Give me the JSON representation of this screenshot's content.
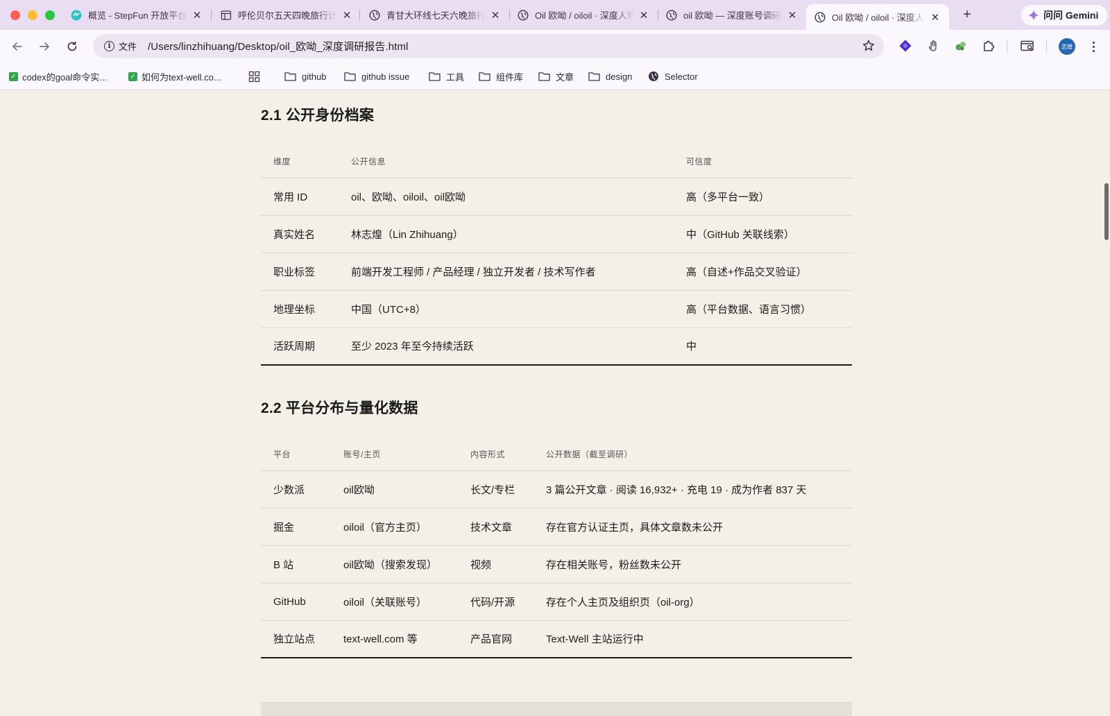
{
  "browser": {
    "tabs": [
      {
        "title": "概览 - StepFun 开放平台",
        "icon": "stepfun-icon"
      },
      {
        "title": "呼伦贝尔五天四晚旅行计划",
        "icon": "doc-icon"
      },
      {
        "title": "青甘大环线七天六晚旅行计划",
        "icon": "globe-icon"
      },
      {
        "title": "Oil 欧呦 / oiloil · 深度人物调研",
        "icon": "globe-icon"
      },
      {
        "title": "oil 欧呦 — 深度账号调研报告",
        "icon": "globe-icon"
      },
      {
        "title": "Oil 欧呦 / oiloil · 深度人物调研",
        "icon": "globe-icon",
        "active": true
      }
    ],
    "gemini_label": "问问 Gemini",
    "address": {
      "chip_label": "文件",
      "url": "/Users/linzhihuang/Desktop/oil_欧呦_深度调研报告.html"
    },
    "avatar_label": "志煌",
    "bookmarks": [
      {
        "label": "codex的goal命令实...",
        "icon": "check-icon"
      },
      {
        "label": "如何为text-well.co...",
        "icon": "check-icon"
      },
      {
        "label": "github",
        "icon": "folder-icon"
      },
      {
        "label": "github issue",
        "icon": "folder-icon"
      },
      {
        "label": "工具",
        "icon": "folder-icon"
      },
      {
        "label": "组件库",
        "icon": "folder-icon"
      },
      {
        "label": "文章",
        "icon": "folder-icon"
      },
      {
        "label": "design",
        "icon": "folder-icon"
      },
      {
        "label": "Selector",
        "icon": "globe-icon"
      }
    ]
  },
  "report": {
    "section_2_1": {
      "title": "2.1 公开身份档案",
      "headers": [
        "维度",
        "公开信息",
        "可信度"
      ],
      "rows": [
        [
          "常用 ID",
          "oil、欧呦、oiloil、oil欧呦",
          "高（多平台一致）"
        ],
        [
          "真实姓名",
          "林志煌（Lin Zhihuang）",
          "中（GitHub 关联线索）"
        ],
        [
          "职业标签",
          "前端开发工程师 / 产品经理 / 独立开发者 / 技术写作者",
          "高（自述+作品交叉验证）"
        ],
        [
          "地理坐标",
          "中国（UTC+8）",
          "高（平台数据、语言习惯）"
        ],
        [
          "活跃周期",
          "至少 2023 年至今持续活跃",
          "中"
        ]
      ]
    },
    "section_2_2": {
      "title": "2.2 平台分布与量化数据",
      "headers": [
        "平台",
        "账号/主页",
        "内容形式",
        "公开数据（截至调研）"
      ],
      "rows": [
        [
          "少数派",
          "oil欧呦",
          "长文/专栏",
          "3 篇公开文章 · 阅读 16,932+ · 充电 19 · 成为作者 837 天"
        ],
        [
          "掘金",
          "oiloil（官方主页）",
          "技术文章",
          "存在官方认证主页，具体文章数未公开"
        ],
        [
          "B 站",
          "oil欧呦（搜索发现）",
          "视频",
          "存在相关账号，粉丝数未公开"
        ],
        [
          "GitHub",
          "oiloil（关联账号）",
          "代码/开源",
          "存在个人主页及组织页（oil-org）"
        ],
        [
          "独立站点",
          "text-well.com 等",
          "产品官网",
          "Text-Well 主站运行中"
        ]
      ]
    }
  },
  "colors": {
    "tabbar_bg": "#e9ddf2",
    "toolbar_bg": "#fbf8fd",
    "page_bg": "#f3f0e8",
    "text": "#1c1c1c"
  }
}
